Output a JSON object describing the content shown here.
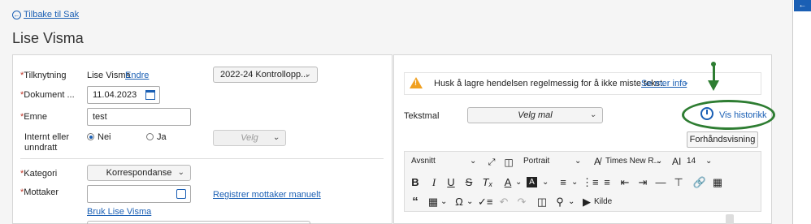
{
  "back_link": "Tilbake til Sak",
  "page_title": "Lise Visma",
  "form": {
    "tilknytning_label": "*Tilknytning",
    "tilknytning_value": "Lise Visma",
    "endre_link": "Endre",
    "kontroll_select": "2022-24 Kontrollopp...",
    "dokument_label": "*Dokument ...",
    "dokument_date": "11.04.2023",
    "emne_label": "*Emne",
    "emne_value": "test",
    "internt_label_1": "Internt eller",
    "internt_label_2": "unndratt",
    "radio_nei": "Nei",
    "radio_ja": "Ja",
    "velg_select": "Velg",
    "kategori_label": "*Kategori",
    "kategori_value": "Korrespondanse",
    "mottaker_label": "*Mottaker",
    "registrer_link": "Registrer mottaker manuelt",
    "bruk_link": "Bruk Lise Visma"
  },
  "notice": {
    "text": "Husk å lagre hendelsen regelmessig for å ikke miste tekst.",
    "more_link": "Se mer info"
  },
  "tekstmal": {
    "label": "Tekstmal",
    "select": "Velg mal"
  },
  "vis_historikk": "Vis historikk",
  "forhandsvisning": "Forhåndsvisning",
  "toolbar": {
    "paragraph": "Avsnitt",
    "orientation": "Portrait",
    "font_name": "Times New R...",
    "font_size": "14",
    "kilde": "Kilde"
  },
  "colors": {
    "accent": "#1a5fb4",
    "highlight": "#2e7d32",
    "warning": "#f0a020"
  }
}
